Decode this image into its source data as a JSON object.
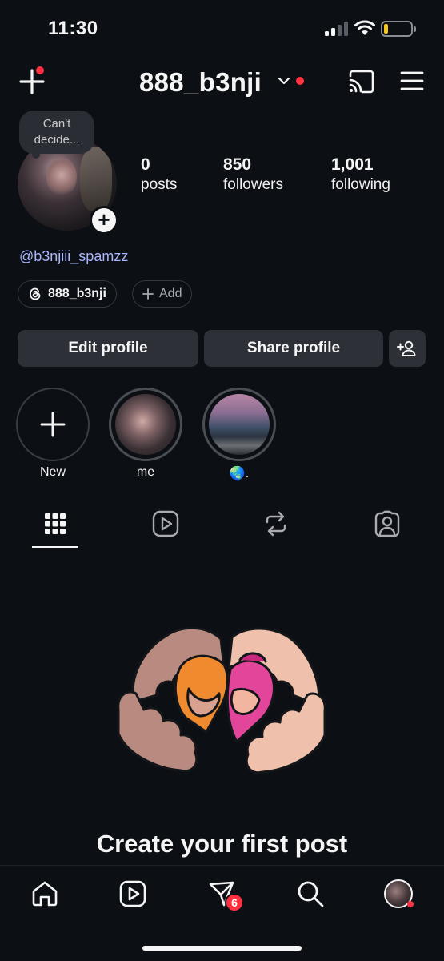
{
  "status_bar": {
    "time": "11:30"
  },
  "header": {
    "username": "888_b3nji"
  },
  "profile": {
    "note": "Can't decide...",
    "stats": [
      {
        "value": "0",
        "label": "posts"
      },
      {
        "value": "850",
        "label": "followers"
      },
      {
        "value": "1,001",
        "label": "following"
      }
    ],
    "link": "@b3njiii_spamzz",
    "threads_chip": "888_b3nji",
    "add_chip": "Add"
  },
  "buttons": {
    "edit": "Edit profile",
    "share": "Share profile"
  },
  "highlights": [
    {
      "label": "New"
    },
    {
      "label": "me"
    },
    {
      "label": "🌏."
    }
  ],
  "empty_state": {
    "title": "Create your first post"
  },
  "bottom_nav": {
    "activity_badge": "6"
  },
  "colors": {
    "background": "#0c0f14",
    "button": "#2d3036",
    "link": "#a9b7ff",
    "notification": "#ff3040"
  },
  "icons": [
    "create-icon",
    "chevron-down-icon",
    "cast-icon",
    "menu-icon",
    "threads-icon",
    "add-user-icon",
    "grid-icon",
    "reels-icon",
    "reposts-icon",
    "tagged-icon",
    "home-icon",
    "reels-nav-icon",
    "activity-icon",
    "search-icon"
  ]
}
